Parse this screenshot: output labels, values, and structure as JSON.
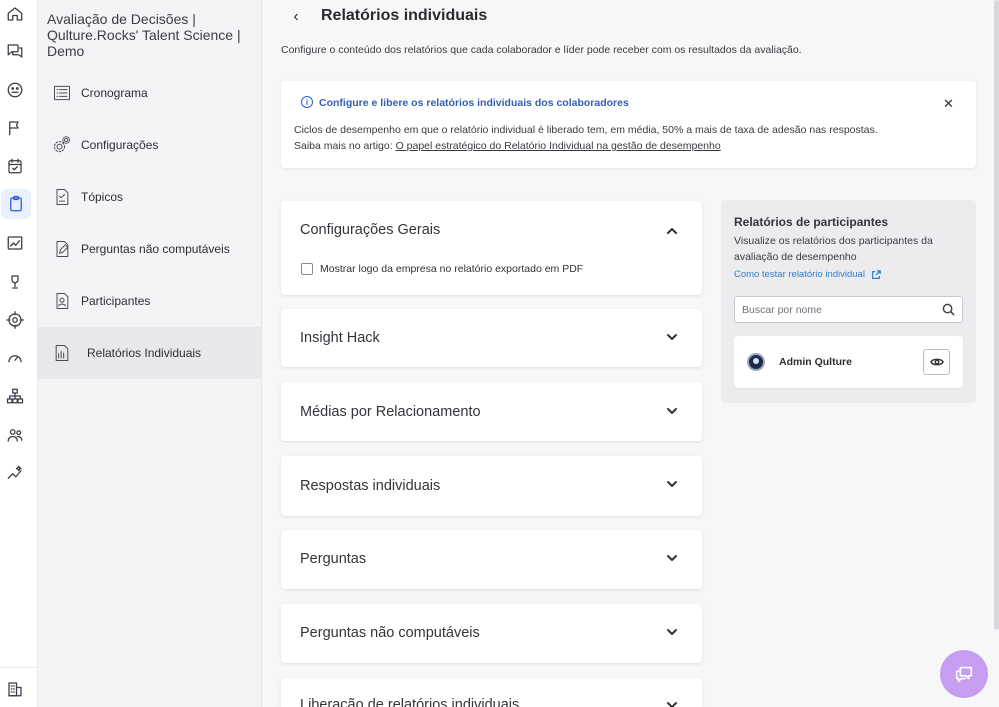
{
  "rail": {
    "icons": [
      "home-icon",
      "chat-icon",
      "mood-icon",
      "flag-icon",
      "calendar-check-icon",
      "clipboard-icon",
      "chart-line-icon",
      "trophy-icon",
      "target-icon",
      "gauge-icon",
      "org-chart-icon",
      "team-icon",
      "sparkle-chart-icon",
      "building-icon"
    ],
    "active": "clipboard-icon"
  },
  "subnav": {
    "title": "Avaliação de Decisões | Qulture.Rocks' Talent Science | Demo",
    "items": [
      {
        "label": "Cronograma",
        "icon": "list-icon"
      },
      {
        "label": "Configurações",
        "icon": "gears-icon"
      },
      {
        "label": "Tópicos",
        "icon": "document-check-icon"
      },
      {
        "label": "Perguntas não computáveis",
        "icon": "edit-document-icon"
      },
      {
        "label": "Participantes",
        "icon": "person-document-icon"
      },
      {
        "label": "Relatórios Individuais",
        "icon": "report-chart-icon",
        "active": true
      }
    ]
  },
  "header": {
    "title": "Relatórios individuais",
    "description": "Configure o conteúdo dos relatórios que cada colaborador e líder pode receber com os resultados da avaliação."
  },
  "banner": {
    "title": "Configure e libere os relatórios individuais dos colaboradores",
    "line1": "Ciclos de desempenho em que o relatório individual é liberado tem, em média, 50% a mais de taxa de adesão nas respostas.",
    "line2_prefix": "Saiba mais no artigo:",
    "link_text": "O papel estratégico do Relatório Individual na gestão de desempenho",
    "info_glyph": "i",
    "close_glyph": "✕"
  },
  "sections": [
    {
      "title": "Configurações Gerais",
      "expanded": true,
      "checkbox_label": "Mostrar logo da empresa no relatório exportado em PDF",
      "checked": false
    },
    {
      "title": "Insight Hack",
      "expanded": false
    },
    {
      "title": "Médias por Relacionamento",
      "expanded": false
    },
    {
      "title": "Respostas individuais",
      "expanded": false
    },
    {
      "title": "Perguntas",
      "expanded": false
    },
    {
      "title": "Perguntas não computáveis",
      "expanded": false
    },
    {
      "title": "Liberação de relatórios individuais",
      "expanded": false
    }
  ],
  "participants_panel": {
    "title": "Relatórios de participantes",
    "description": "Visualize os relatórios dos participantes da avaliação de desempenho",
    "link_text": "Como testar relatório individual",
    "search_placeholder": "Buscar por nome",
    "participants": [
      {
        "name": "Admin Qulture"
      }
    ]
  },
  "colors": {
    "accent": "#2f5bd3",
    "link": "#2f7fd0",
    "chat_fab": "#c69df0"
  }
}
